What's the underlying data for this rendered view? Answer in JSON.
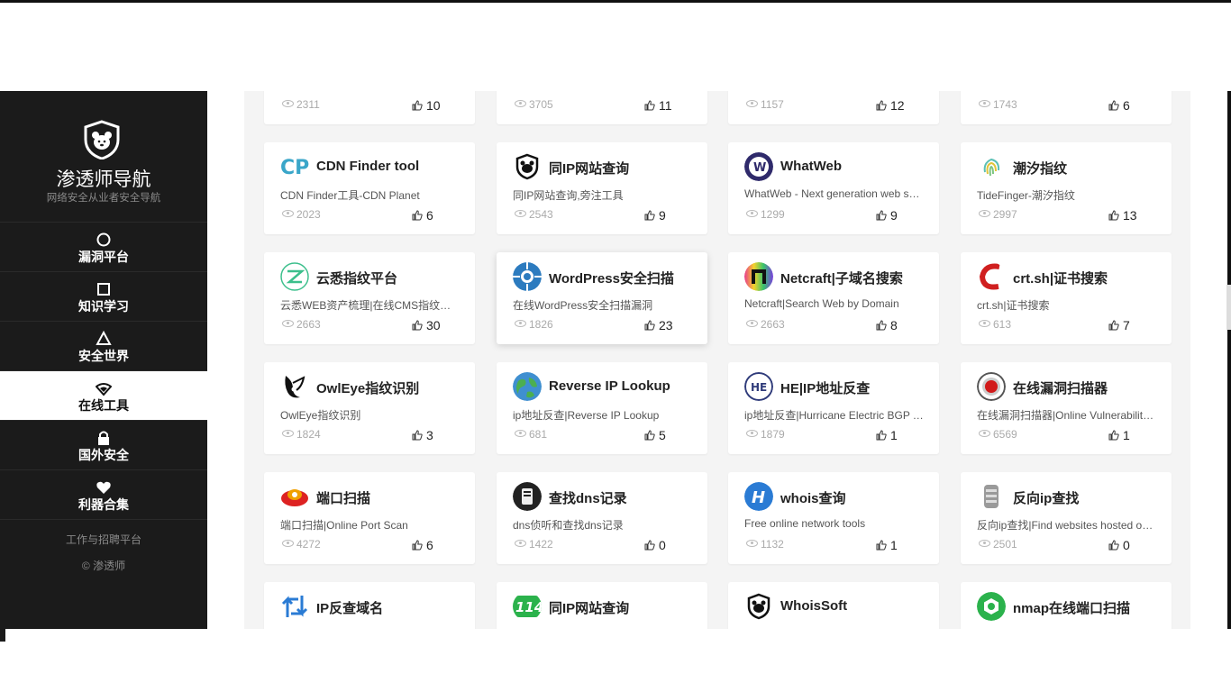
{
  "brand": {
    "title": "渗透师导航",
    "subtitle": "网络安全从业者安全导航",
    "logo_icon": "shield-bear-icon"
  },
  "nav": [
    {
      "label": "漏洞平台",
      "icon": "circle-icon"
    },
    {
      "label": "知识学习",
      "icon": "square-icon"
    },
    {
      "label": "安全世界",
      "icon": "triangle-icon"
    },
    {
      "label": "在线工具",
      "icon": "wifi-icon",
      "active": true
    },
    {
      "label": "国外安全",
      "icon": "lock-icon"
    },
    {
      "label": "利器合集",
      "icon": "heart-icon"
    }
  ],
  "sidebar_footer": {
    "link": "工作与招聘平台",
    "copyright": "© 渗透师"
  },
  "top_row": [
    {
      "views": "2311",
      "likes": "10"
    },
    {
      "views": "3705",
      "likes": "11"
    },
    {
      "views": "1157",
      "likes": "12"
    },
    {
      "views": "1743",
      "likes": "6"
    }
  ],
  "cards": [
    {
      "title": "CDN Finder tool",
      "desc": "CDN Finder工具-CDN Planet",
      "views": "2023",
      "likes": "6",
      "icon": "cp-logo-icon"
    },
    {
      "title": "同IP网站查询",
      "desc": "同IP网站查询,旁注工具",
      "views": "2543",
      "likes": "9",
      "icon": "bear-shield-icon"
    },
    {
      "title": "WhatWeb",
      "desc": "WhatWeb - Next generation web scanner",
      "views": "1299",
      "likes": "9",
      "icon": "whatweb-logo-icon"
    },
    {
      "title": "潮汐指纹",
      "desc": "TideFinger-潮汐指纹",
      "views": "2997",
      "likes": "13",
      "icon": "fingerprint-icon"
    },
    {
      "title": "云悉指纹平台",
      "desc": "云悉WEB资产梳理|在线CMS指纹识别平台",
      "views": "2663",
      "likes": "30",
      "icon": "yunxi-logo-icon"
    },
    {
      "title": "WordPress安全扫描",
      "desc": "在线WordPress安全扫描漏洞",
      "views": "1826",
      "likes": "23",
      "icon": "wordpress-scan-icon"
    },
    {
      "title": "Netcraft|子域名搜索",
      "desc": "Netcraft|Search Web by Domain",
      "views": "2663",
      "likes": "8",
      "icon": "netcraft-logo-icon"
    },
    {
      "title": "crt.sh|证书搜索",
      "desc": "crt.sh|证书搜索",
      "views": "613",
      "likes": "7",
      "icon": "crtsh-logo-icon"
    },
    {
      "title": "OwlEye指纹识别",
      "desc": "OwlEye指纹识别",
      "views": "1824",
      "likes": "3",
      "icon": "owl-logo-icon"
    },
    {
      "title": "Reverse IP Lookup",
      "desc": "ip地址反查|Reverse IP Lookup",
      "views": "681",
      "likes": "5",
      "icon": "globe-icon"
    },
    {
      "title": "HE|IP地址反查",
      "desc": "ip地址反查|Hurricane Electric BGP Toolkit",
      "views": "1879",
      "likes": "1",
      "icon": "he-logo-icon"
    },
    {
      "title": "在线漏洞扫描器",
      "desc": "在线漏洞扫描器|Online Vulnerability Scanner",
      "views": "6569",
      "likes": "1",
      "icon": "target-icon"
    },
    {
      "title": "端口扫描",
      "desc": "端口扫描|Online Port Scan",
      "views": "4272",
      "likes": "6",
      "icon": "port-scan-icon"
    },
    {
      "title": "查找dns记录",
      "desc": "dns侦听和查找dns记录",
      "views": "1422",
      "likes": "0",
      "icon": "dns-logo-icon"
    },
    {
      "title": "whois查询",
      "desc": "Free online network tools",
      "views": "1132",
      "likes": "1",
      "icon": "whois-logo-icon"
    },
    {
      "title": "反向ip查找",
      "desc": "反向ip查找|Find websites hosted on IP",
      "views": "2501",
      "likes": "0",
      "icon": "server-icon"
    },
    {
      "title": "IP反查域名",
      "desc": "",
      "views": "",
      "likes": "",
      "icon": "reverse-arrows-icon"
    },
    {
      "title": "同IP网站查询",
      "desc": "",
      "views": "",
      "likes": "",
      "icon": "114-logo-icon"
    },
    {
      "title": "WhoisSoft",
      "desc": "",
      "views": "",
      "likes": "",
      "icon": "bear-shield-icon"
    },
    {
      "title": "nmap在线端口扫描",
      "desc": "",
      "views": "",
      "likes": "",
      "icon": "hexagon-icon"
    }
  ]
}
